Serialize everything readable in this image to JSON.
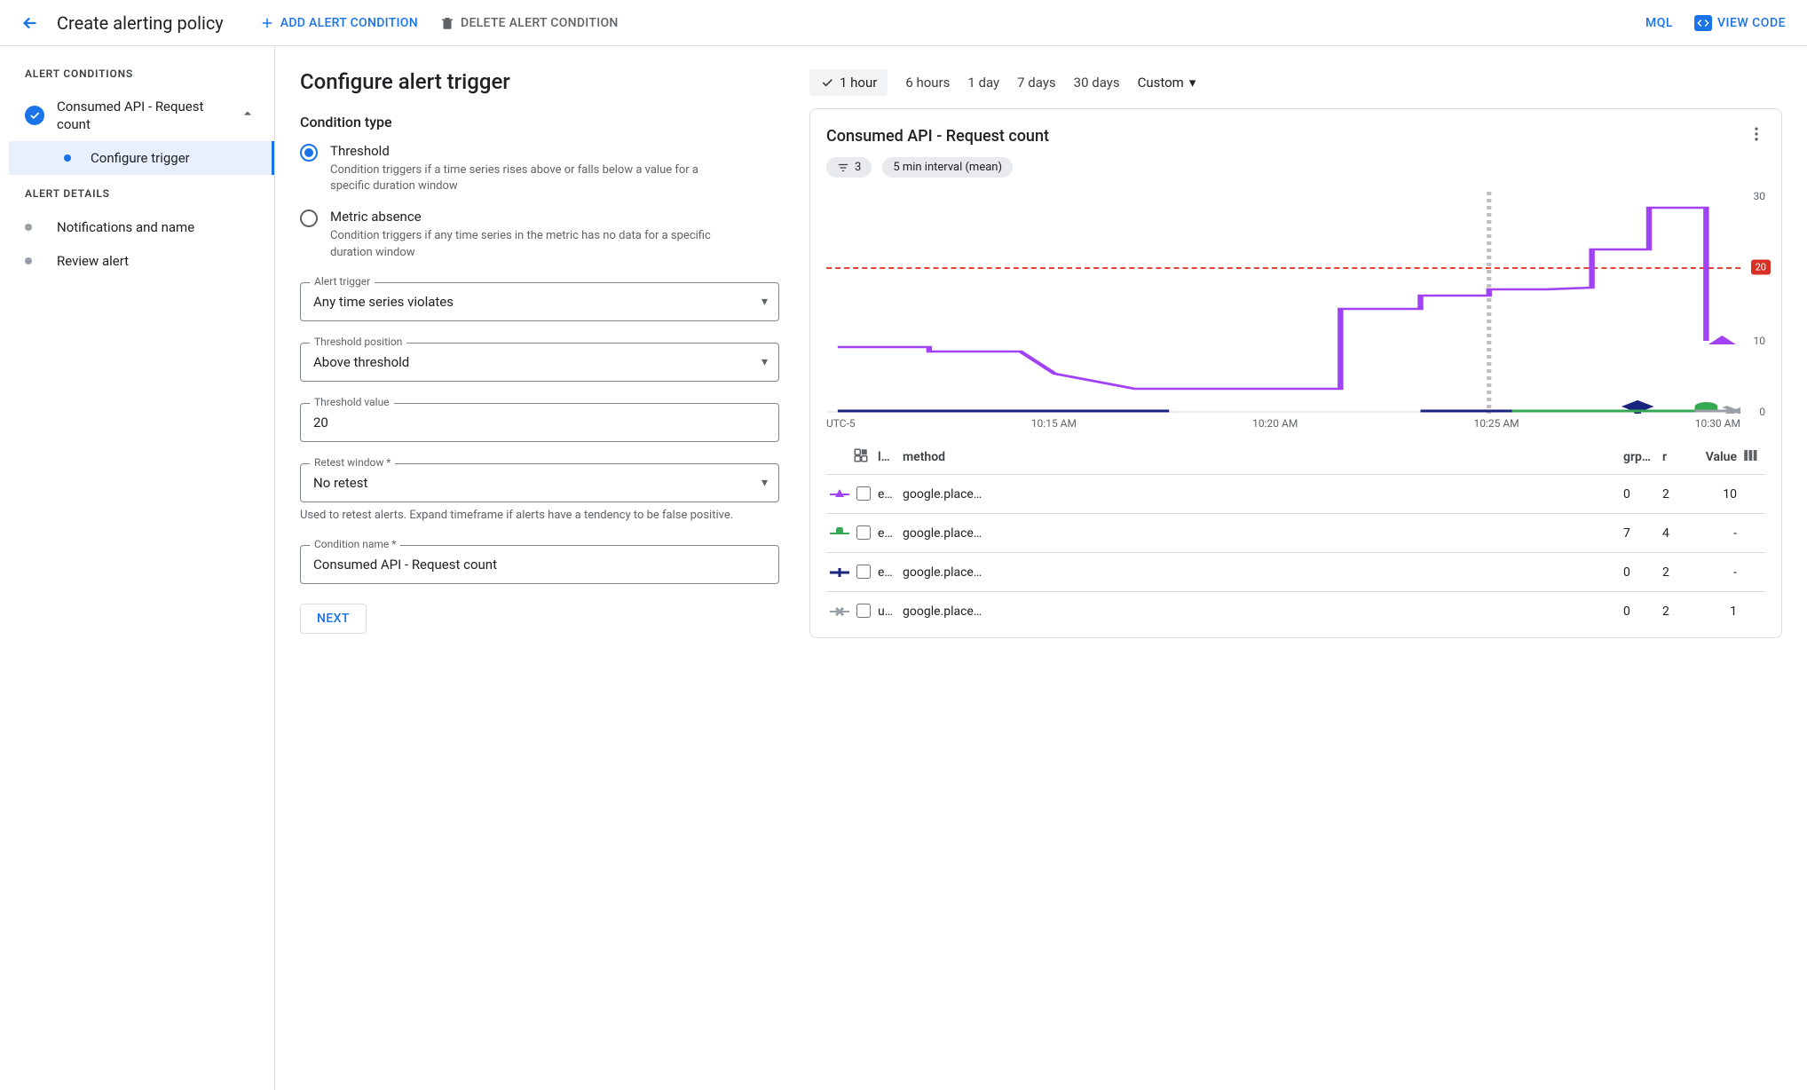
{
  "header": {
    "title": "Create alerting policy",
    "add_condition": "ADD ALERT CONDITION",
    "delete_condition": "DELETE ALERT CONDITION",
    "mql": "MQL",
    "view_code": "VIEW CODE"
  },
  "sidebar": {
    "section_conditions": "ALERT CONDITIONS",
    "condition_name": "Consumed API - Request count",
    "sub_configure": "Configure trigger",
    "section_details": "ALERT DETAILS",
    "item_notifications": "Notifications and name",
    "item_review": "Review alert"
  },
  "form": {
    "title": "Configure alert trigger",
    "condition_type_label": "Condition type",
    "threshold": {
      "label": "Threshold",
      "desc": "Condition triggers if a time series rises above or falls below a value for a specific duration window"
    },
    "metric_absence": {
      "label": "Metric absence",
      "desc": "Condition triggers if any time series in the metric has no data for a specific duration window"
    },
    "alert_trigger": {
      "legend": "Alert trigger",
      "value": "Any time series violates"
    },
    "threshold_position": {
      "legend": "Threshold position",
      "value": "Above threshold"
    },
    "threshold_value": {
      "legend": "Threshold value",
      "value": "20"
    },
    "retest": {
      "legend": "Retest window *",
      "value": "No retest",
      "helper": "Used to retest alerts. Expand timeframe if alerts have a tendency to be false positive."
    },
    "condition_name": {
      "legend": "Condition name *",
      "value": "Consumed API - Request count"
    },
    "next": "NEXT"
  },
  "time_range": {
    "selected": "1 hour",
    "opts": [
      "6 hours",
      "1 day",
      "7 days",
      "30 days"
    ],
    "custom": "Custom"
  },
  "chart_card": {
    "title": "Consumed API - Request count",
    "filter_count": "3",
    "interval": "5 min interval (mean)",
    "threshold": 20,
    "y_ticks": [
      0,
      10,
      20,
      30
    ],
    "timezone": "UTC-5",
    "x_ticks": [
      "10:15 AM",
      "10:20 AM",
      "10:25 AM",
      "10:30 AM"
    ],
    "legend_head": {
      "l": "l…",
      "method": "method",
      "grp": "grp…",
      "r": "r",
      "value": "Value"
    },
    "rows": [
      {
        "mark_color": "#a142f4",
        "mark_shape": "triangle",
        "l": "e…",
        "method": "google.place…",
        "grp": "0",
        "r": "2",
        "value": "10"
      },
      {
        "mark_color": "#34a853",
        "mark_shape": "square",
        "l": "e…",
        "method": "google.place…",
        "grp": "7",
        "r": "4",
        "value": "-"
      },
      {
        "mark_color": "#1a237e",
        "mark_shape": "plus",
        "l": "e…",
        "method": "google.place…",
        "grp": "0",
        "r": "2",
        "value": "-"
      },
      {
        "mark_color": "#9aa0a6",
        "mark_shape": "x",
        "l": "u…",
        "method": "google.place…",
        "grp": "0",
        "r": "2",
        "value": "1"
      }
    ]
  },
  "chart_data": {
    "type": "line",
    "title": "Consumed API - Request count",
    "ylabel": "",
    "xlabel": "",
    "ylim": [
      0,
      30
    ],
    "threshold": 20,
    "x": [
      "10:10",
      "10:12",
      "10:14",
      "10:16",
      "10:18",
      "10:20",
      "10:22",
      "10:24",
      "10:26",
      "10:28",
      "10:30",
      "10:32"
    ],
    "series": [
      {
        "name": "e / google.place… (purple)",
        "color": "#a142f4",
        "values": [
          9,
          9,
          8,
          8,
          5,
          3,
          3,
          3,
          14,
          16,
          16,
          17,
          17,
          22,
          28,
          28,
          10
        ]
      },
      {
        "name": "e / google.place… (green)",
        "color": "#34a853",
        "values": [
          null,
          null,
          null,
          null,
          null,
          null,
          null,
          null,
          null,
          null,
          0,
          0,
          0,
          0,
          0,
          0,
          null
        ]
      },
      {
        "name": "e / google.place… (navy)",
        "color": "#1a237e",
        "values": [
          0,
          0,
          0,
          0,
          0,
          0,
          null,
          null,
          null,
          null,
          0,
          0,
          0,
          0,
          0,
          0,
          null
        ]
      },
      {
        "name": "u / google.place… (grey)",
        "color": "#9aa0a6",
        "values": [
          null,
          null,
          null,
          null,
          null,
          null,
          null,
          null,
          null,
          null,
          null,
          null,
          null,
          null,
          0,
          0,
          null
        ]
      }
    ]
  }
}
